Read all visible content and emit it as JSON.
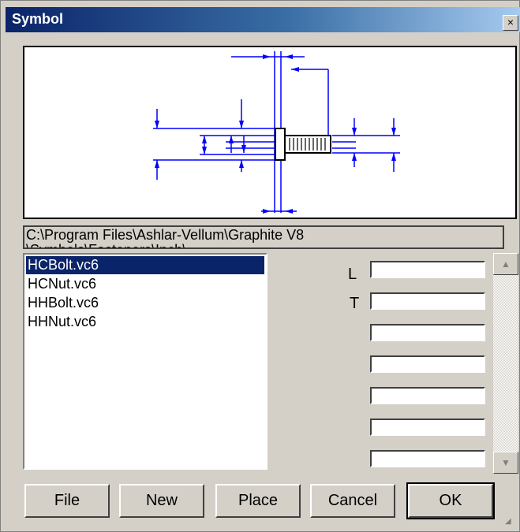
{
  "window": {
    "title": "Symbol",
    "close_glyph": "×"
  },
  "path": {
    "line1": "C:\\Program Files\\Ashlar-Vellum\\Graphite V8",
    "line2": "\\Symbols\\Fasteners\\Inch\\"
  },
  "files": {
    "items": [
      "HCBolt.vc6",
      "HCNut.vc6",
      "HHBolt.vc6",
      "HHNut.vc6"
    ],
    "selected": "HCBolt.vc6"
  },
  "params": {
    "labels": [
      "L",
      "T"
    ],
    "field_count": 7
  },
  "buttons": {
    "file": "File",
    "new": "New",
    "place": "Place",
    "cancel": "Cancel",
    "ok": "OK"
  },
  "scroll": {
    "up_glyph": "▲",
    "down_glyph": "▼"
  },
  "colors": {
    "title_bar": "#0a246a",
    "selection": "#0a246a",
    "dimension_lines": "#0000ff",
    "dialog_bg": "#d4d0c8"
  }
}
